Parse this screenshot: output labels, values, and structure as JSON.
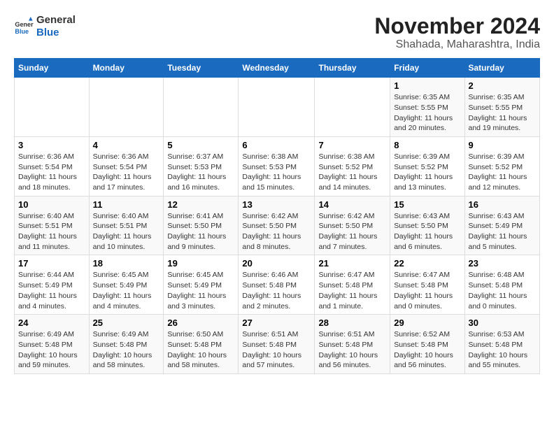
{
  "logo": {
    "line1": "General",
    "line2": "Blue"
  },
  "title": "November 2024",
  "subtitle": "Shahada, Maharashtra, India",
  "days_of_week": [
    "Sunday",
    "Monday",
    "Tuesday",
    "Wednesday",
    "Thursday",
    "Friday",
    "Saturday"
  ],
  "weeks": [
    [
      {
        "day": "",
        "text": ""
      },
      {
        "day": "",
        "text": ""
      },
      {
        "day": "",
        "text": ""
      },
      {
        "day": "",
        "text": ""
      },
      {
        "day": "",
        "text": ""
      },
      {
        "day": "1",
        "text": "Sunrise: 6:35 AM\nSunset: 5:55 PM\nDaylight: 11 hours and 20 minutes."
      },
      {
        "day": "2",
        "text": "Sunrise: 6:35 AM\nSunset: 5:55 PM\nDaylight: 11 hours and 19 minutes."
      }
    ],
    [
      {
        "day": "3",
        "text": "Sunrise: 6:36 AM\nSunset: 5:54 PM\nDaylight: 11 hours and 18 minutes."
      },
      {
        "day": "4",
        "text": "Sunrise: 6:36 AM\nSunset: 5:54 PM\nDaylight: 11 hours and 17 minutes."
      },
      {
        "day": "5",
        "text": "Sunrise: 6:37 AM\nSunset: 5:53 PM\nDaylight: 11 hours and 16 minutes."
      },
      {
        "day": "6",
        "text": "Sunrise: 6:38 AM\nSunset: 5:53 PM\nDaylight: 11 hours and 15 minutes."
      },
      {
        "day": "7",
        "text": "Sunrise: 6:38 AM\nSunset: 5:52 PM\nDaylight: 11 hours and 14 minutes."
      },
      {
        "day": "8",
        "text": "Sunrise: 6:39 AM\nSunset: 5:52 PM\nDaylight: 11 hours and 13 minutes."
      },
      {
        "day": "9",
        "text": "Sunrise: 6:39 AM\nSunset: 5:52 PM\nDaylight: 11 hours and 12 minutes."
      }
    ],
    [
      {
        "day": "10",
        "text": "Sunrise: 6:40 AM\nSunset: 5:51 PM\nDaylight: 11 hours and 11 minutes."
      },
      {
        "day": "11",
        "text": "Sunrise: 6:40 AM\nSunset: 5:51 PM\nDaylight: 11 hours and 10 minutes."
      },
      {
        "day": "12",
        "text": "Sunrise: 6:41 AM\nSunset: 5:50 PM\nDaylight: 11 hours and 9 minutes."
      },
      {
        "day": "13",
        "text": "Sunrise: 6:42 AM\nSunset: 5:50 PM\nDaylight: 11 hours and 8 minutes."
      },
      {
        "day": "14",
        "text": "Sunrise: 6:42 AM\nSunset: 5:50 PM\nDaylight: 11 hours and 7 minutes."
      },
      {
        "day": "15",
        "text": "Sunrise: 6:43 AM\nSunset: 5:50 PM\nDaylight: 11 hours and 6 minutes."
      },
      {
        "day": "16",
        "text": "Sunrise: 6:43 AM\nSunset: 5:49 PM\nDaylight: 11 hours and 5 minutes."
      }
    ],
    [
      {
        "day": "17",
        "text": "Sunrise: 6:44 AM\nSunset: 5:49 PM\nDaylight: 11 hours and 4 minutes."
      },
      {
        "day": "18",
        "text": "Sunrise: 6:45 AM\nSunset: 5:49 PM\nDaylight: 11 hours and 4 minutes."
      },
      {
        "day": "19",
        "text": "Sunrise: 6:45 AM\nSunset: 5:49 PM\nDaylight: 11 hours and 3 minutes."
      },
      {
        "day": "20",
        "text": "Sunrise: 6:46 AM\nSunset: 5:48 PM\nDaylight: 11 hours and 2 minutes."
      },
      {
        "day": "21",
        "text": "Sunrise: 6:47 AM\nSunset: 5:48 PM\nDaylight: 11 hours and 1 minute."
      },
      {
        "day": "22",
        "text": "Sunrise: 6:47 AM\nSunset: 5:48 PM\nDaylight: 11 hours and 0 minutes."
      },
      {
        "day": "23",
        "text": "Sunrise: 6:48 AM\nSunset: 5:48 PM\nDaylight: 11 hours and 0 minutes."
      }
    ],
    [
      {
        "day": "24",
        "text": "Sunrise: 6:49 AM\nSunset: 5:48 PM\nDaylight: 10 hours and 59 minutes."
      },
      {
        "day": "25",
        "text": "Sunrise: 6:49 AM\nSunset: 5:48 PM\nDaylight: 10 hours and 58 minutes."
      },
      {
        "day": "26",
        "text": "Sunrise: 6:50 AM\nSunset: 5:48 PM\nDaylight: 10 hours and 58 minutes."
      },
      {
        "day": "27",
        "text": "Sunrise: 6:51 AM\nSunset: 5:48 PM\nDaylight: 10 hours and 57 minutes."
      },
      {
        "day": "28",
        "text": "Sunrise: 6:51 AM\nSunset: 5:48 PM\nDaylight: 10 hours and 56 minutes."
      },
      {
        "day": "29",
        "text": "Sunrise: 6:52 AM\nSunset: 5:48 PM\nDaylight: 10 hours and 56 minutes."
      },
      {
        "day": "30",
        "text": "Sunrise: 6:53 AM\nSunset: 5:48 PM\nDaylight: 10 hours and 55 minutes."
      }
    ]
  ]
}
